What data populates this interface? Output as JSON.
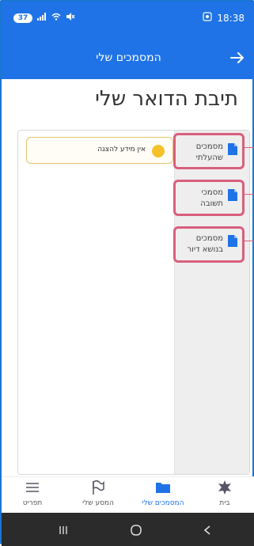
{
  "status_bar": {
    "battery": "37",
    "time": "18:38"
  },
  "header": {
    "title": "המסמכים שלי"
  },
  "page": {
    "title": "תיבת הדואר שלי"
  },
  "sidebar": {
    "items": [
      {
        "label": "מסמכים שהעלתי"
      },
      {
        "label": "מסמכי תשובה"
      },
      {
        "label": "מסמכים בנושא דיור"
      }
    ]
  },
  "notice": {
    "text": "אין מידע להצגה"
  },
  "bottom_nav": {
    "items": [
      {
        "label": "בית"
      },
      {
        "label": "המסמכים שלי"
      },
      {
        "label": "המסע שלי"
      },
      {
        "label": "תפריט"
      }
    ]
  },
  "colors": {
    "primary": "#1f73e6",
    "highlight": "#d95f7d",
    "notice_dot": "#f4c12a"
  }
}
